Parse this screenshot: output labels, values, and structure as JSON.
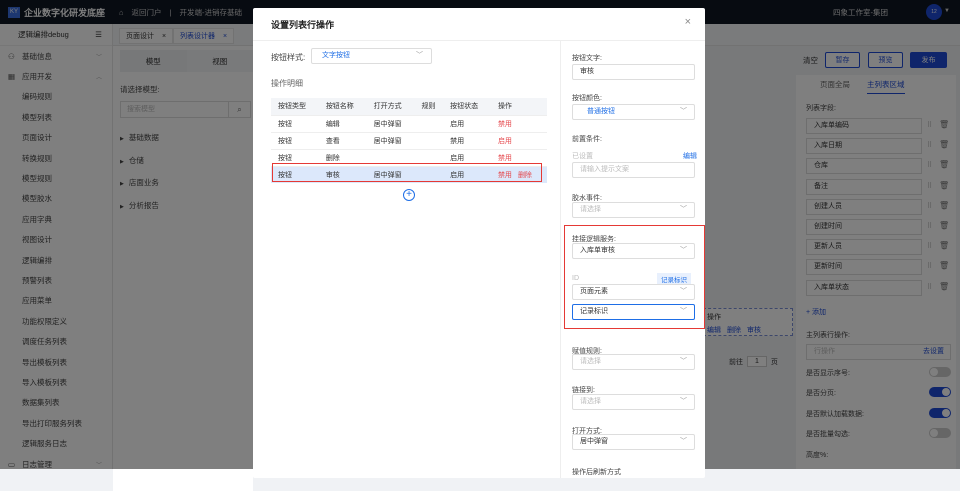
{
  "topbar": {
    "logo": "KY",
    "brand": "企业数字化研发底座",
    "home": "返回门户",
    "project": "开发端-进销存基础",
    "org": "四象工作室-集团",
    "avatar": "12"
  },
  "sidebar": {
    "title": "逻辑编排debug",
    "groups": [
      {
        "label": "基础信息"
      },
      {
        "label": "应用开发"
      }
    ],
    "items": [
      "编码规则",
      "模型列表",
      "页面设计",
      "转换规则",
      "模型规则",
      "模型胶水",
      "应用字典",
      "视图设计",
      "逻辑编排",
      "预警列表",
      "应用菜单",
      "功能权限定义",
      "调度任务列表",
      "导出模板列表",
      "导入模板列表",
      "数据集列表",
      "导出打印服务列表",
      "逻辑服务日志"
    ],
    "footer_group": "日志管理"
  },
  "page_tabs": [
    {
      "label": "页面设计"
    },
    {
      "label": "列表设计器"
    }
  ],
  "model_panel": {
    "seg": [
      "模型",
      "视图"
    ],
    "select_label": "请选择模型:",
    "search_placeholder": "搜索模型",
    "tree": [
      "基础数据",
      "仓储",
      "店面业务",
      "分析报告"
    ]
  },
  "toolbar": {
    "clear": "清空",
    "save": "暂存",
    "preview": "预览",
    "publish": "发布"
  },
  "right_panel": {
    "tabs": [
      "页面全局",
      "主列表区域"
    ],
    "fields_label": "列表字段:",
    "fields": [
      "入库单编码",
      "入库日期",
      "仓库",
      "备注",
      "创建人员",
      "创建时间",
      "更新人员",
      "更新时间",
      "入库单状态"
    ],
    "add": "+ 添加",
    "row_ops_label": "主列表行操作:",
    "row_ops_placeholder": "行操作",
    "go_set": "去设置",
    "toggles": [
      {
        "label": "是否显示序号:",
        "on": false
      },
      {
        "label": "是否分页:",
        "on": true
      },
      {
        "label": "是否默认加载数据:",
        "on": true
      },
      {
        "label": "是否批量勾选:",
        "on": false
      }
    ],
    "height_label": "高度%:"
  },
  "canvas": {
    "ops_header": "操作",
    "ops": [
      "编辑",
      "删除",
      "审核"
    ],
    "goto": "前往",
    "page": "1",
    "page_unit": "页"
  },
  "modal": {
    "title": "设置列表行操作",
    "button_style_label": "按钮样式:",
    "button_style": "文字按钮",
    "detail_label": "操作明细",
    "columns": [
      "按钮类型",
      "按钮名称",
      "打开方式",
      "规则",
      "按钮状态",
      "操作"
    ],
    "rows": [
      {
        "type": "按钮",
        "name": "编辑",
        "open": "居中弹窗",
        "rule": "",
        "status": "启用",
        "action": "禁用",
        "del": ""
      },
      {
        "type": "按钮",
        "name": "查看",
        "open": "居中弹窗",
        "rule": "",
        "status": "禁用",
        "action": "启用",
        "del": ""
      },
      {
        "type": "按钮",
        "name": "删除",
        "open": "",
        "rule": "",
        "status": "启用",
        "action": "禁用",
        "del": ""
      },
      {
        "type": "按钮",
        "name": "审核",
        "open": "居中弹窗",
        "rule": "",
        "status": "启用",
        "action": "禁用",
        "del": "删除"
      }
    ],
    "form": {
      "text_label": "按钮文字:",
      "text_value": "审核",
      "color_label": "按钮颜色:",
      "color_value": "普通按钮",
      "pre_label": "前置条件:",
      "pre_set": "已设置",
      "pre_edit": "编辑",
      "pre_placeholder": "请输入提示文案",
      "glue_label": "胶水事件:",
      "glue_placeholder": "请选择",
      "service_label": "挂接逻辑服务:",
      "service_value": "入库单审核",
      "id_label": "ID",
      "id_badge": "记录标识",
      "id_source": "页面元素",
      "id_field": "记录标识",
      "assign_label": "赋值规则:",
      "assign_placeholder": "请选择",
      "link_label": "链接到:",
      "link_placeholder": "请选择",
      "open_label": "打开方式:",
      "open_value": "居中弹窗",
      "refresh_label": "操作后刷新方式"
    }
  }
}
